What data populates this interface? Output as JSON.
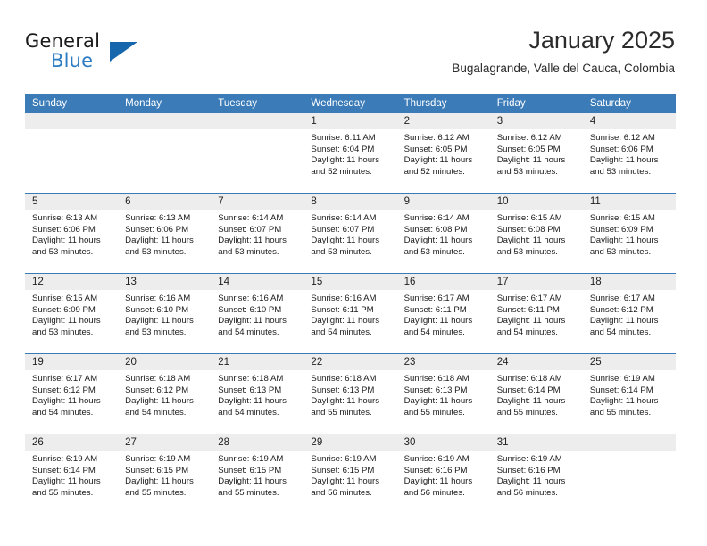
{
  "brand": {
    "name_part1": "General",
    "name_part2": "Blue",
    "triangle_color": "#1566ac",
    "blue_text_color": "#2b7cc3"
  },
  "header": {
    "title": "January 2025",
    "subtitle": "Bugalagrande, Valle del Cauca, Colombia",
    "accent_color": "#3b7cb8"
  },
  "weekdays": [
    "Sunday",
    "Monday",
    "Tuesday",
    "Wednesday",
    "Thursday",
    "Friday",
    "Saturday"
  ],
  "labels": {
    "sunrise_prefix": "Sunrise:",
    "sunset_prefix": "Sunset:",
    "daylight_prefix": "Daylight:"
  },
  "weeks": [
    [
      {
        "day": "",
        "sunrise": "",
        "sunset": "",
        "daylight_line1": "",
        "daylight_line2": ""
      },
      {
        "day": "",
        "sunrise": "",
        "sunset": "",
        "daylight_line1": "",
        "daylight_line2": ""
      },
      {
        "day": "",
        "sunrise": "",
        "sunset": "",
        "daylight_line1": "",
        "daylight_line2": ""
      },
      {
        "day": "1",
        "sunrise": "Sunrise: 6:11 AM",
        "sunset": "Sunset: 6:04 PM",
        "daylight_line1": "Daylight: 11 hours",
        "daylight_line2": "and 52 minutes."
      },
      {
        "day": "2",
        "sunrise": "Sunrise: 6:12 AM",
        "sunset": "Sunset: 6:05 PM",
        "daylight_line1": "Daylight: 11 hours",
        "daylight_line2": "and 52 minutes."
      },
      {
        "day": "3",
        "sunrise": "Sunrise: 6:12 AM",
        "sunset": "Sunset: 6:05 PM",
        "daylight_line1": "Daylight: 11 hours",
        "daylight_line2": "and 53 minutes."
      },
      {
        "day": "4",
        "sunrise": "Sunrise: 6:12 AM",
        "sunset": "Sunset: 6:06 PM",
        "daylight_line1": "Daylight: 11 hours",
        "daylight_line2": "and 53 minutes."
      }
    ],
    [
      {
        "day": "5",
        "sunrise": "Sunrise: 6:13 AM",
        "sunset": "Sunset: 6:06 PM",
        "daylight_line1": "Daylight: 11 hours",
        "daylight_line2": "and 53 minutes."
      },
      {
        "day": "6",
        "sunrise": "Sunrise: 6:13 AM",
        "sunset": "Sunset: 6:06 PM",
        "daylight_line1": "Daylight: 11 hours",
        "daylight_line2": "and 53 minutes."
      },
      {
        "day": "7",
        "sunrise": "Sunrise: 6:14 AM",
        "sunset": "Sunset: 6:07 PM",
        "daylight_line1": "Daylight: 11 hours",
        "daylight_line2": "and 53 minutes."
      },
      {
        "day": "8",
        "sunrise": "Sunrise: 6:14 AM",
        "sunset": "Sunset: 6:07 PM",
        "daylight_line1": "Daylight: 11 hours",
        "daylight_line2": "and 53 minutes."
      },
      {
        "day": "9",
        "sunrise": "Sunrise: 6:14 AM",
        "sunset": "Sunset: 6:08 PM",
        "daylight_line1": "Daylight: 11 hours",
        "daylight_line2": "and 53 minutes."
      },
      {
        "day": "10",
        "sunrise": "Sunrise: 6:15 AM",
        "sunset": "Sunset: 6:08 PM",
        "daylight_line1": "Daylight: 11 hours",
        "daylight_line2": "and 53 minutes."
      },
      {
        "day": "11",
        "sunrise": "Sunrise: 6:15 AM",
        "sunset": "Sunset: 6:09 PM",
        "daylight_line1": "Daylight: 11 hours",
        "daylight_line2": "and 53 minutes."
      }
    ],
    [
      {
        "day": "12",
        "sunrise": "Sunrise: 6:15 AM",
        "sunset": "Sunset: 6:09 PM",
        "daylight_line1": "Daylight: 11 hours",
        "daylight_line2": "and 53 minutes."
      },
      {
        "day": "13",
        "sunrise": "Sunrise: 6:16 AM",
        "sunset": "Sunset: 6:10 PM",
        "daylight_line1": "Daylight: 11 hours",
        "daylight_line2": "and 53 minutes."
      },
      {
        "day": "14",
        "sunrise": "Sunrise: 6:16 AM",
        "sunset": "Sunset: 6:10 PM",
        "daylight_line1": "Daylight: 11 hours",
        "daylight_line2": "and 54 minutes."
      },
      {
        "day": "15",
        "sunrise": "Sunrise: 6:16 AM",
        "sunset": "Sunset: 6:11 PM",
        "daylight_line1": "Daylight: 11 hours",
        "daylight_line2": "and 54 minutes."
      },
      {
        "day": "16",
        "sunrise": "Sunrise: 6:17 AM",
        "sunset": "Sunset: 6:11 PM",
        "daylight_line1": "Daylight: 11 hours",
        "daylight_line2": "and 54 minutes."
      },
      {
        "day": "17",
        "sunrise": "Sunrise: 6:17 AM",
        "sunset": "Sunset: 6:11 PM",
        "daylight_line1": "Daylight: 11 hours",
        "daylight_line2": "and 54 minutes."
      },
      {
        "day": "18",
        "sunrise": "Sunrise: 6:17 AM",
        "sunset": "Sunset: 6:12 PM",
        "daylight_line1": "Daylight: 11 hours",
        "daylight_line2": "and 54 minutes."
      }
    ],
    [
      {
        "day": "19",
        "sunrise": "Sunrise: 6:17 AM",
        "sunset": "Sunset: 6:12 PM",
        "daylight_line1": "Daylight: 11 hours",
        "daylight_line2": "and 54 minutes."
      },
      {
        "day": "20",
        "sunrise": "Sunrise: 6:18 AM",
        "sunset": "Sunset: 6:12 PM",
        "daylight_line1": "Daylight: 11 hours",
        "daylight_line2": "and 54 minutes."
      },
      {
        "day": "21",
        "sunrise": "Sunrise: 6:18 AM",
        "sunset": "Sunset: 6:13 PM",
        "daylight_line1": "Daylight: 11 hours",
        "daylight_line2": "and 54 minutes."
      },
      {
        "day": "22",
        "sunrise": "Sunrise: 6:18 AM",
        "sunset": "Sunset: 6:13 PM",
        "daylight_line1": "Daylight: 11 hours",
        "daylight_line2": "and 55 minutes."
      },
      {
        "day": "23",
        "sunrise": "Sunrise: 6:18 AM",
        "sunset": "Sunset: 6:13 PM",
        "daylight_line1": "Daylight: 11 hours",
        "daylight_line2": "and 55 minutes."
      },
      {
        "day": "24",
        "sunrise": "Sunrise: 6:18 AM",
        "sunset": "Sunset: 6:14 PM",
        "daylight_line1": "Daylight: 11 hours",
        "daylight_line2": "and 55 minutes."
      },
      {
        "day": "25",
        "sunrise": "Sunrise: 6:19 AM",
        "sunset": "Sunset: 6:14 PM",
        "daylight_line1": "Daylight: 11 hours",
        "daylight_line2": "and 55 minutes."
      }
    ],
    [
      {
        "day": "26",
        "sunrise": "Sunrise: 6:19 AM",
        "sunset": "Sunset: 6:14 PM",
        "daylight_line1": "Daylight: 11 hours",
        "daylight_line2": "and 55 minutes."
      },
      {
        "day": "27",
        "sunrise": "Sunrise: 6:19 AM",
        "sunset": "Sunset: 6:15 PM",
        "daylight_line1": "Daylight: 11 hours",
        "daylight_line2": "and 55 minutes."
      },
      {
        "day": "28",
        "sunrise": "Sunrise: 6:19 AM",
        "sunset": "Sunset: 6:15 PM",
        "daylight_line1": "Daylight: 11 hours",
        "daylight_line2": "and 55 minutes."
      },
      {
        "day": "29",
        "sunrise": "Sunrise: 6:19 AM",
        "sunset": "Sunset: 6:15 PM",
        "daylight_line1": "Daylight: 11 hours",
        "daylight_line2": "and 56 minutes."
      },
      {
        "day": "30",
        "sunrise": "Sunrise: 6:19 AM",
        "sunset": "Sunset: 6:16 PM",
        "daylight_line1": "Daylight: 11 hours",
        "daylight_line2": "and 56 minutes."
      },
      {
        "day": "31",
        "sunrise": "Sunrise: 6:19 AM",
        "sunset": "Sunset: 6:16 PM",
        "daylight_line1": "Daylight: 11 hours",
        "daylight_line2": "and 56 minutes."
      },
      {
        "day": "",
        "sunrise": "",
        "sunset": "",
        "daylight_line1": "",
        "daylight_line2": ""
      }
    ]
  ]
}
